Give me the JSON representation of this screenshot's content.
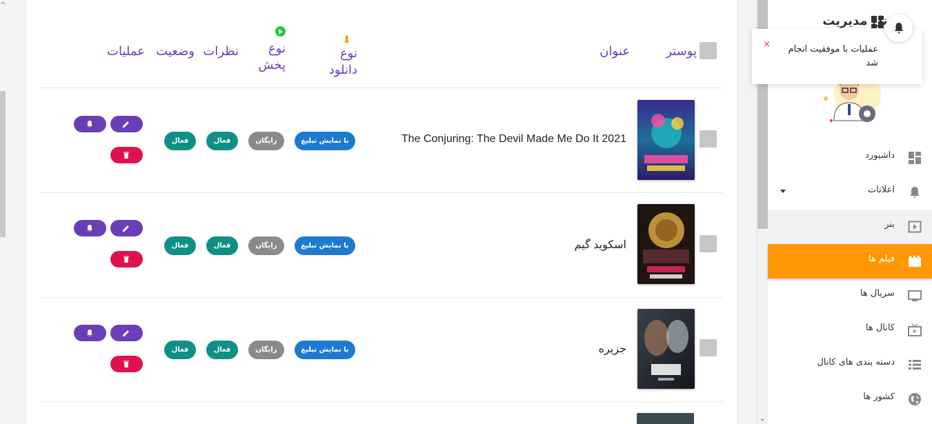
{
  "sidebar": {
    "brand": "پنل مدیریت",
    "items": [
      {
        "label": "داشبورد",
        "icon": "dashboard-icon"
      },
      {
        "label": "اعلانات",
        "icon": "bell-icon"
      },
      {
        "label": "بنر",
        "icon": "banner-icon"
      },
      {
        "label": "فیلم ها",
        "icon": "movie-icon"
      },
      {
        "label": "سریال ها",
        "icon": "tv-icon"
      },
      {
        "label": "کانال ها",
        "icon": "channel-icon"
      },
      {
        "label": "دسته بندی های کانال",
        "icon": "list-icon"
      },
      {
        "label": "کشور ها",
        "icon": "globe-icon"
      }
    ]
  },
  "toast": {
    "message": "عملیات با موفقیت انجام شد",
    "close": "×"
  },
  "table": {
    "headers": {
      "poster": "پوستر",
      "title": "عنوان",
      "download_type": "نوع دانلود",
      "play_type": "نوع پخش",
      "comments": "نظرات",
      "status": "وضعیت",
      "operations": "عملیات"
    },
    "rows": [
      {
        "title": "The Conjuring: The Devil Made Me Do It 2021",
        "download": "با نمایش تبلیغ",
        "play": "رایگان",
        "comments": "فعال",
        "status": "فعال",
        "poster_colors": [
          "#2b1d66",
          "#ff4fa3",
          "#22c1c3"
        ]
      },
      {
        "title": "اسکوید گیم",
        "download": "با نمایش تبلیغ",
        "play": "رایگان",
        "comments": "فعال",
        "status": "فعال",
        "poster_colors": [
          "#1e1410",
          "#d9a441",
          "#e2265a"
        ]
      },
      {
        "title": "جزیره",
        "download": "با نمایش تبلیغ",
        "play": "رایگان",
        "comments": "فعال",
        "status": "فعال",
        "poster_colors": [
          "#20252c",
          "#8b6a55",
          "#c2c9d1"
        ]
      }
    ]
  },
  "colors": {
    "accent": "#ff9800",
    "purple": "#6a3fb5",
    "blue": "#1e7ad0",
    "teal": "#0f9084",
    "grey": "#8a8a8a",
    "danger": "#e0114f"
  }
}
